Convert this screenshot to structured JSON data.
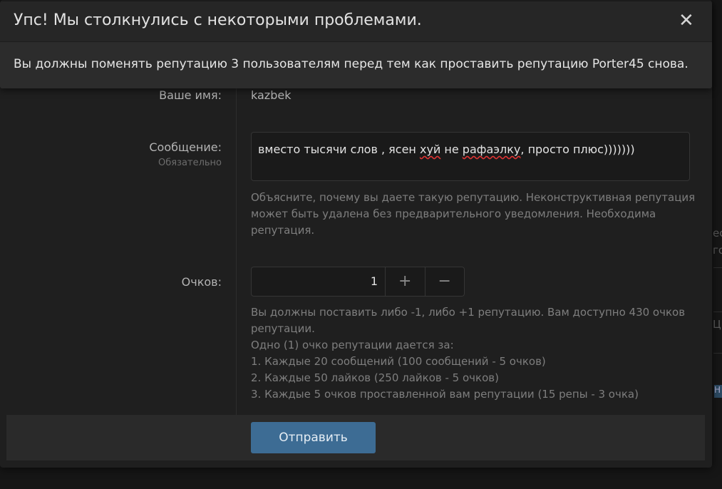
{
  "background": {
    "right_fragments": [
      "ес",
      "го",
      "Ци",
      "Н"
    ]
  },
  "error": {
    "title": "Упс! Мы столкнулись с некоторыми проблемами.",
    "close_symbol": "✕",
    "message": "Вы должны поменять репутацию 3 пользователям перед тем как проставить репутацию Porter45 снова."
  },
  "form": {
    "name_label": "Ваше имя:",
    "name_value": "kazbek",
    "message_label": "Сообщение:",
    "message_required": "Обязательно",
    "message_parts": {
      "p1": "вместо тысячи слов , ясен ",
      "p2": "хуй",
      "p3": " не ",
      "p4": "рафаэлку",
      "p5": ", просто плюс)))))))"
    },
    "message_hint": "Объясните, почему вы даете такую репутацию. Неконструктивная репутация может быть удалена без предварительного уведомления. Необходима репутация.",
    "points_label": "Очков:",
    "points_value": "1",
    "points_plus": "+",
    "points_minus": "−",
    "points_hint": [
      "Вы должны поставить либо -1, либо +1 репутацию. Вам доступно 430 очков репутации.",
      "Одно (1) очко репутации дается за:",
      "1. Каждые 20 сообщений (100 сообщений - 5 очков)",
      "2. Каждые 50 лайков (250 лайков - 5 очков)",
      "3. Каждые 5 очков проставленной вам репутации (15 репы - 3 очка)"
    ]
  },
  "footer": {
    "submit_label": "Отправить"
  },
  "colors": {
    "accent_button": "#3d6c94",
    "dialog_bg": "#1f1f1f",
    "overlay_bg": "#2c2c2c"
  }
}
